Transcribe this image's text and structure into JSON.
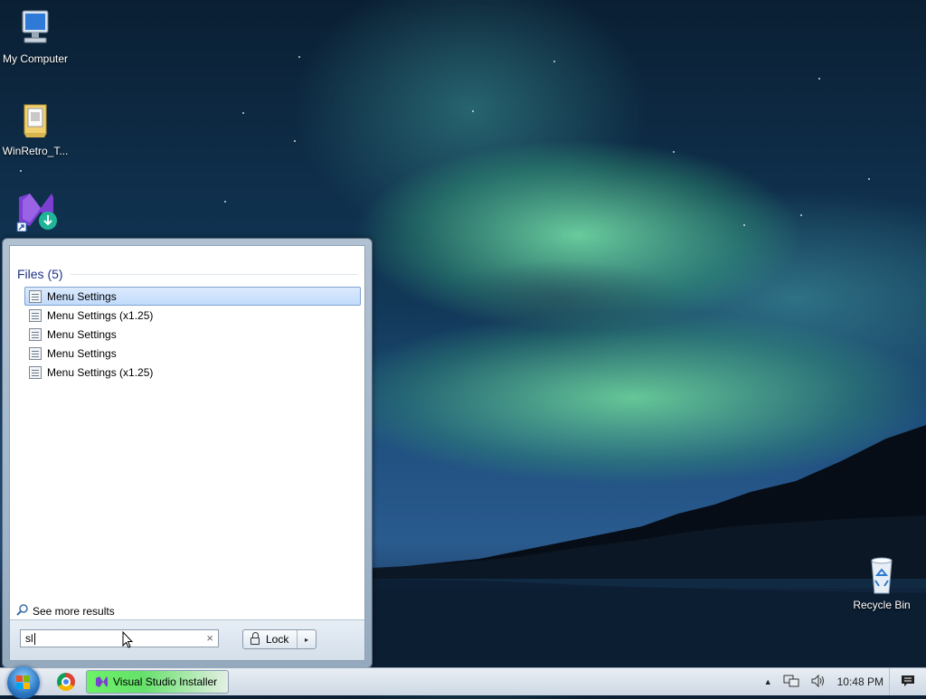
{
  "desktop": {
    "icons": [
      {
        "label": "My Computer",
        "icon": "computer-icon"
      },
      {
        "label": "WinRetro_T...",
        "icon": "folder-icon"
      },
      {
        "label": "",
        "icon": "visual-studio-installer-icon"
      },
      {
        "label": "Recycle Bin",
        "icon": "recycle-bin-icon"
      }
    ]
  },
  "start_menu": {
    "group_header": "Files (5)",
    "results": [
      {
        "label": "Menu Settings",
        "icon": "settings-file-icon",
        "selected": true
      },
      {
        "label": "Menu Settings (x1.25)",
        "icon": "settings-file-icon",
        "selected": false
      },
      {
        "label": "Menu Settings",
        "icon": "settings-file-icon",
        "selected": false
      },
      {
        "label": "Menu Settings",
        "icon": "settings-file-icon",
        "selected": false
      },
      {
        "label": "Menu Settings (x1.25)",
        "icon": "settings-file-icon",
        "selected": false
      }
    ],
    "see_more": "See more results",
    "search": {
      "value": "sl",
      "clear_icon": "×"
    },
    "lock_button": {
      "label": "Lock",
      "arrow": "▸"
    }
  },
  "taskbar": {
    "start_button": "windows-orb-icon",
    "pinned": [
      {
        "name": "chrome-icon"
      }
    ],
    "open_app": {
      "label": "Visual Studio Installer",
      "icon": "visual-studio-icon"
    },
    "tray": {
      "show_hidden": "▲",
      "clock": "10:48 PM"
    }
  },
  "colors": {
    "accent": "#1e3287",
    "selection": "#c1dbfc",
    "taskbar_highlight": "#6cf266"
  }
}
